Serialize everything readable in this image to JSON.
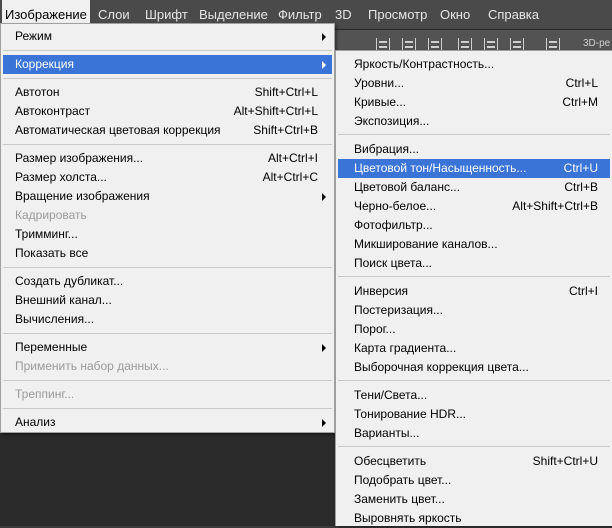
{
  "menubar": {
    "items": [
      "Изображение",
      "Слои",
      "Шрифт",
      "Выделение",
      "Фильтр",
      "3D",
      "Просмотр",
      "Окно",
      "Справка"
    ]
  },
  "optionsbar": {
    "label": "3D-ре"
  },
  "image_menu": {
    "items": [
      {
        "label": "Режим",
        "shortcut": "",
        "submenu": true
      },
      {
        "label": "Коррекция",
        "shortcut": "",
        "submenu": true,
        "highlighted": true
      },
      {
        "label": "Автотон",
        "shortcut": "Shift+Ctrl+L"
      },
      {
        "label": "Автоконтраст",
        "shortcut": "Alt+Shift+Ctrl+L"
      },
      {
        "label": "Автоматическая цветовая коррекция",
        "shortcut": "Shift+Ctrl+B"
      },
      {
        "label": "Размер изображения...",
        "shortcut": "Alt+Ctrl+I"
      },
      {
        "label": "Размер холста...",
        "shortcut": "Alt+Ctrl+C"
      },
      {
        "label": "Вращение изображения",
        "shortcut": "",
        "submenu": true
      },
      {
        "label": "Кадрировать",
        "shortcut": "",
        "disabled": true
      },
      {
        "label": "Тримминг...",
        "shortcut": ""
      },
      {
        "label": "Показать все",
        "shortcut": ""
      },
      {
        "label": "Создать дубликат...",
        "shortcut": ""
      },
      {
        "label": "Внешний канал...",
        "shortcut": ""
      },
      {
        "label": "Вычисления...",
        "shortcut": ""
      },
      {
        "label": "Переменные",
        "shortcut": "",
        "submenu": true
      },
      {
        "label": "Применить набор данных...",
        "shortcut": "",
        "disabled": true
      },
      {
        "label": "Треппинг...",
        "shortcut": "",
        "disabled": true
      },
      {
        "label": "Анализ",
        "shortcut": "",
        "submenu": true
      }
    ]
  },
  "adjustments_menu": {
    "items": [
      {
        "label": "Яркость/Контрастность...",
        "shortcut": ""
      },
      {
        "label": "Уровни...",
        "shortcut": "Ctrl+L"
      },
      {
        "label": "Кривые...",
        "shortcut": "Ctrl+M"
      },
      {
        "label": "Экспозиция...",
        "shortcut": ""
      },
      {
        "label": "Вибрация...",
        "shortcut": ""
      },
      {
        "label": "Цветовой тон/Насыщенность...",
        "shortcut": "Ctrl+U",
        "highlighted": true
      },
      {
        "label": "Цветовой баланс...",
        "shortcut": "Ctrl+B"
      },
      {
        "label": "Черно-белое...",
        "shortcut": "Alt+Shift+Ctrl+B"
      },
      {
        "label": "Фотофильтр...",
        "shortcut": ""
      },
      {
        "label": "Микширование каналов...",
        "shortcut": ""
      },
      {
        "label": "Поиск цвета...",
        "shortcut": ""
      },
      {
        "label": "Инверсия",
        "shortcut": "Ctrl+I"
      },
      {
        "label": "Постеризация...",
        "shortcut": ""
      },
      {
        "label": "Порог...",
        "shortcut": ""
      },
      {
        "label": "Карта градиента...",
        "shortcut": ""
      },
      {
        "label": "Выборочная коррекция цвета...",
        "shortcut": ""
      },
      {
        "label": "Тени/Света...",
        "shortcut": ""
      },
      {
        "label": "Тонирование HDR...",
        "shortcut": ""
      },
      {
        "label": "Варианты...",
        "shortcut": ""
      },
      {
        "label": "Обесцветить",
        "shortcut": "Shift+Ctrl+U"
      },
      {
        "label": "Подобрать цвет...",
        "shortcut": ""
      },
      {
        "label": "Заменить цвет...",
        "shortcut": ""
      },
      {
        "label": "Выровнять яркость",
        "shortcut": ""
      }
    ]
  }
}
